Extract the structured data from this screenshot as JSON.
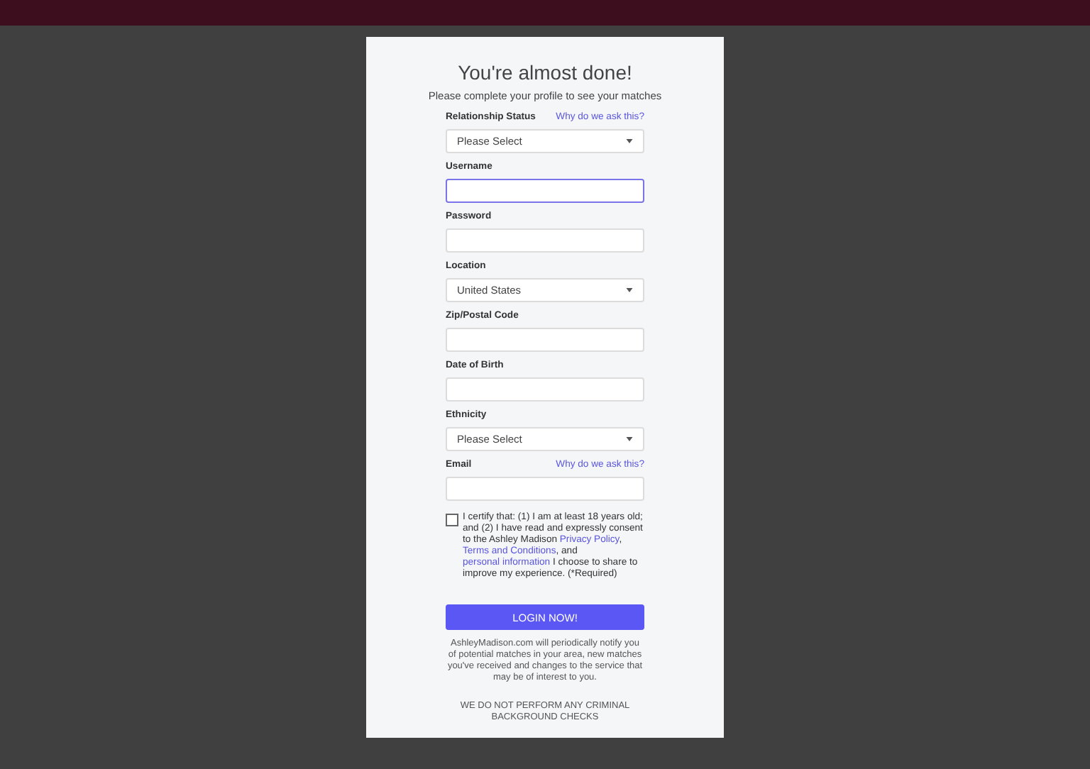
{
  "dialog": {
    "title": "You're almost done!",
    "subtitle": "Please complete your profile to see your matches",
    "fields": [
      {
        "label": "Relationship Status",
        "kind": "select",
        "value": "Please Select",
        "help_link": "Why do we ask this?",
        "focused": false
      },
      {
        "label": "Username",
        "kind": "text",
        "focused": true
      },
      {
        "label": "Password",
        "kind": "text",
        "focused": false
      },
      {
        "label": "Location",
        "kind": "select",
        "value": "United States",
        "focused": false
      },
      {
        "label": "Zip/Postal Code",
        "kind": "text",
        "focused": false
      },
      {
        "label": "Date of Birth",
        "kind": "text",
        "focused": false
      },
      {
        "label": "Ethnicity",
        "kind": "select",
        "value": "Please Select",
        "focused": false
      },
      {
        "label": "Email",
        "kind": "text",
        "help_link": "Why do we ask this?",
        "focused": false
      }
    ],
    "consent": {
      "checked": false,
      "parts": [
        {
          "text": "I certify that: (1) I am at least 18 years old; and (2) I have read and expressly consent to the Ashley Madison ",
          "link": false
        },
        {
          "text": "Privacy Policy",
          "link": true
        },
        {
          "text": ", ",
          "link": false
        },
        {
          "text": "Terms and Conditions",
          "link": true
        },
        {
          "text": ", and ",
          "link": false
        },
        {
          "text": "personal information",
          "link": true
        },
        {
          "text": " I choose to share to improve my experience. (*Required)",
          "link": false
        }
      ]
    },
    "submit": "LOGIN NOW!",
    "notice": "AshleyMadison.com will periodically notify you of potential matches in your area, new matches you've received and changes to the service that may be of interest to you.",
    "disclaimer": "WE DO NOT PERFORM ANY CRIMINAL BACKGROUND CHECKS"
  }
}
